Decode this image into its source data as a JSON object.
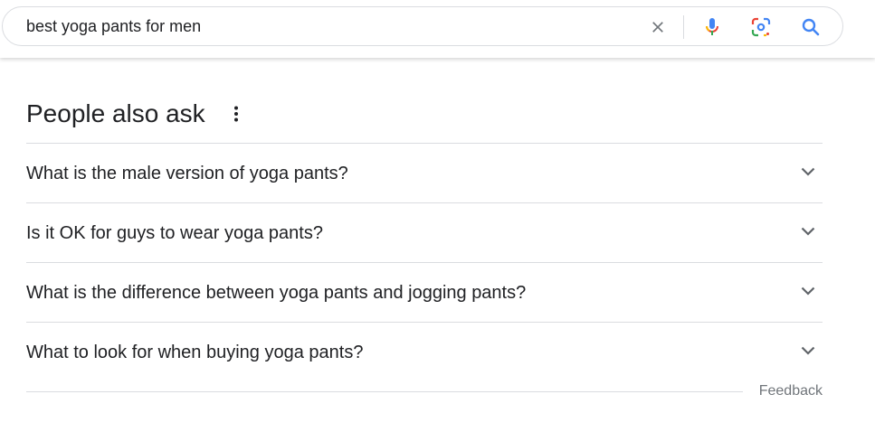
{
  "search": {
    "query": "best yoga pants for men",
    "icons": [
      "close-icon",
      "mic-icon",
      "lens-icon",
      "search-icon"
    ]
  },
  "people_also_ask": {
    "title": "People also ask",
    "questions": [
      "What is the male version of yoga pants?",
      "Is it OK for guys to wear yoga pants?",
      "What is the difference between yoga pants and jogging pants?",
      "What to look for when buying yoga pants?"
    ],
    "feedback_label": "Feedback"
  },
  "colors": {
    "text": "#202124",
    "muted": "#70757a",
    "divider": "#dadce0",
    "google_blue": "#4285f4",
    "google_red": "#ea4335",
    "google_yellow": "#fbbc04",
    "google_green": "#34a853"
  }
}
